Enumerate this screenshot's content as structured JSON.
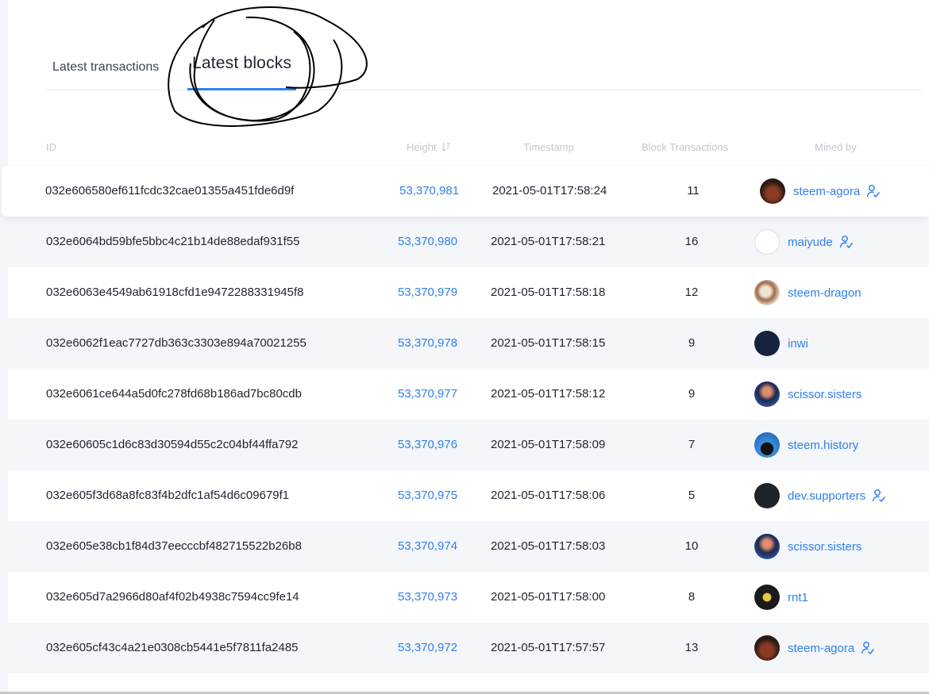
{
  "tabs": [
    {
      "label": "Latest transactions",
      "active": false
    },
    {
      "label": "Latest blocks",
      "active": true
    }
  ],
  "table": {
    "headers": {
      "id": "ID",
      "height": "Height",
      "timestamp": "Timestamp",
      "block_transactions": "Block Transactions",
      "mined_by": "Mined by"
    },
    "sort": {
      "column": "height",
      "direction": "descending"
    },
    "rows": [
      {
        "id": "032e606580ef611fcdc32cae01355a451fde6d9f",
        "height": "53,370,981",
        "timestamp": "2021-05-01T17:58:24",
        "transactions": "11",
        "miner": "steem-agora",
        "verified": true,
        "avatar": "agora"
      },
      {
        "id": "032e6064bd59bfe5bbc4c21b14de88edaf931f55",
        "height": "53,370,980",
        "timestamp": "2021-05-01T17:58:21",
        "transactions": "16",
        "miner": "maiyude",
        "verified": true,
        "avatar": "maiyude"
      },
      {
        "id": "032e6063e4549ab61918cfd1e9472288331945f8",
        "height": "53,370,979",
        "timestamp": "2021-05-01T17:58:18",
        "transactions": "12",
        "miner": "steem-dragon",
        "verified": false,
        "avatar": "dragon"
      },
      {
        "id": "032e6062f1eac7727db363c3303e894a70021255",
        "height": "53,370,978",
        "timestamp": "2021-05-01T17:58:15",
        "transactions": "9",
        "miner": "inwi",
        "verified": false,
        "avatar": "inwi"
      },
      {
        "id": "032e6061ce644a5d0fc278fd68b186ad7bc80cdb",
        "height": "53,370,977",
        "timestamp": "2021-05-01T17:58:12",
        "transactions": "9",
        "miner": "scissor.sisters",
        "verified": false,
        "avatar": "sisters"
      },
      {
        "id": "032e60605c1d6c83d30594d55c2c04bf44ffa792",
        "height": "53,370,976",
        "timestamp": "2021-05-01T17:58:09",
        "transactions": "7",
        "miner": "steem.history",
        "verified": false,
        "avatar": "history"
      },
      {
        "id": "032e605f3d68a8fc83f4b2dfc1af54d6c09679f1",
        "height": "53,370,975",
        "timestamp": "2021-05-01T17:58:06",
        "transactions": "5",
        "miner": "dev.supporters",
        "verified": true,
        "avatar": "dev"
      },
      {
        "id": "032e605e38cb1f84d37eecccbf482715522b26b8",
        "height": "53,370,974",
        "timestamp": "2021-05-01T17:58:03",
        "transactions": "10",
        "miner": "scissor.sisters",
        "verified": false,
        "avatar": "sisters"
      },
      {
        "id": "032e605d7a2966d80af4f02b4938c7594cc9fe14",
        "height": "53,370,973",
        "timestamp": "2021-05-01T17:58:00",
        "transactions": "8",
        "miner": "rnt1",
        "verified": false,
        "avatar": "rnt1"
      },
      {
        "id": "032e605cf43c4a21e0308cb5441e5f7811fa2485",
        "height": "53,370,972",
        "timestamp": "2021-05-01T17:57:57",
        "transactions": "13",
        "miner": "steem-agora",
        "verified": true,
        "avatar": "agora"
      }
    ]
  },
  "icons": {
    "sort": "sort-descending-icon",
    "verify": "verified-user-icon"
  },
  "colors": {
    "accent": "#2f80ed",
    "row_alt": "#f4f6f9",
    "header_text": "#c2c7d0",
    "annotation": "#000000"
  }
}
